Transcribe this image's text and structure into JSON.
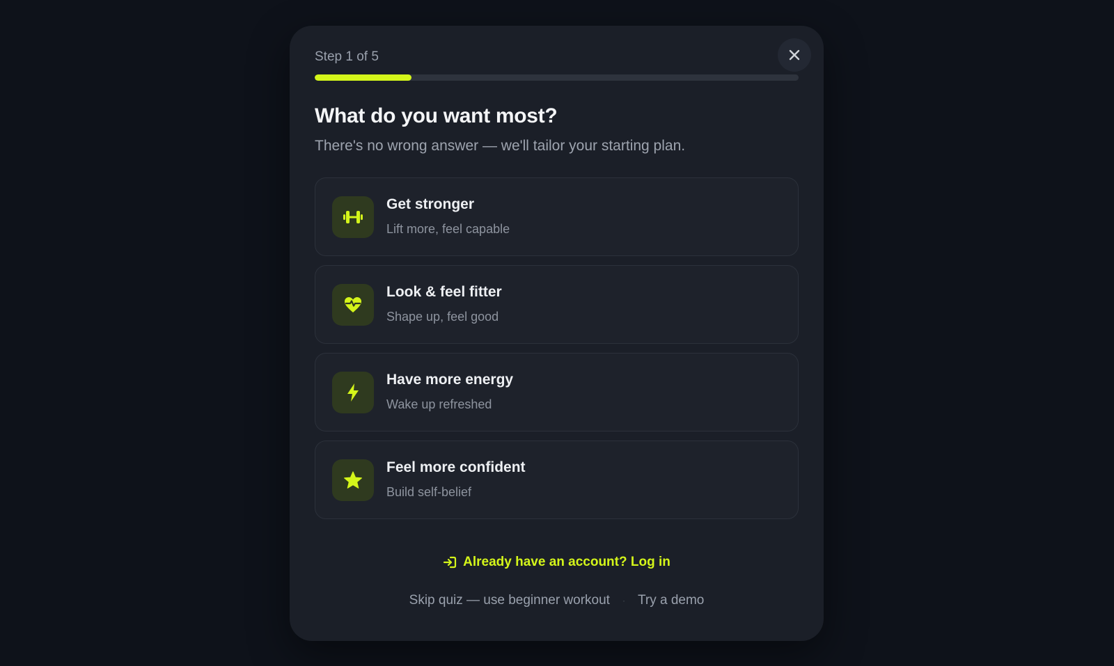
{
  "colors": {
    "accent": "#d4f51a",
    "background": "#0e121a",
    "modal": "#1b1f28"
  },
  "step": {
    "label": "Step 1 of 5",
    "progress_fraction": 0.2
  },
  "close": {
    "icon": "close-icon"
  },
  "title": "What do you want most?",
  "subtitle": "There's no wrong answer — we'll tailor your starting plan.",
  "options": [
    {
      "title": "Get stronger",
      "description": "Lift more, feel capable",
      "icon": "dumbbell-icon"
    },
    {
      "title": "Look & feel fitter",
      "description": "Shape up, feel good",
      "icon": "heart-pulse-icon"
    },
    {
      "title": "Have more energy",
      "description": "Wake up refreshed",
      "icon": "lightning-icon"
    },
    {
      "title": "Feel more confident",
      "description": "Build self-belief",
      "icon": "star-icon"
    }
  ],
  "login": {
    "label": "Already have an account? Log in",
    "icon": "login-icon"
  },
  "footer": {
    "skip_label": "Skip quiz — use beginner workout",
    "separator": "·",
    "demo_label": "Try a demo"
  }
}
